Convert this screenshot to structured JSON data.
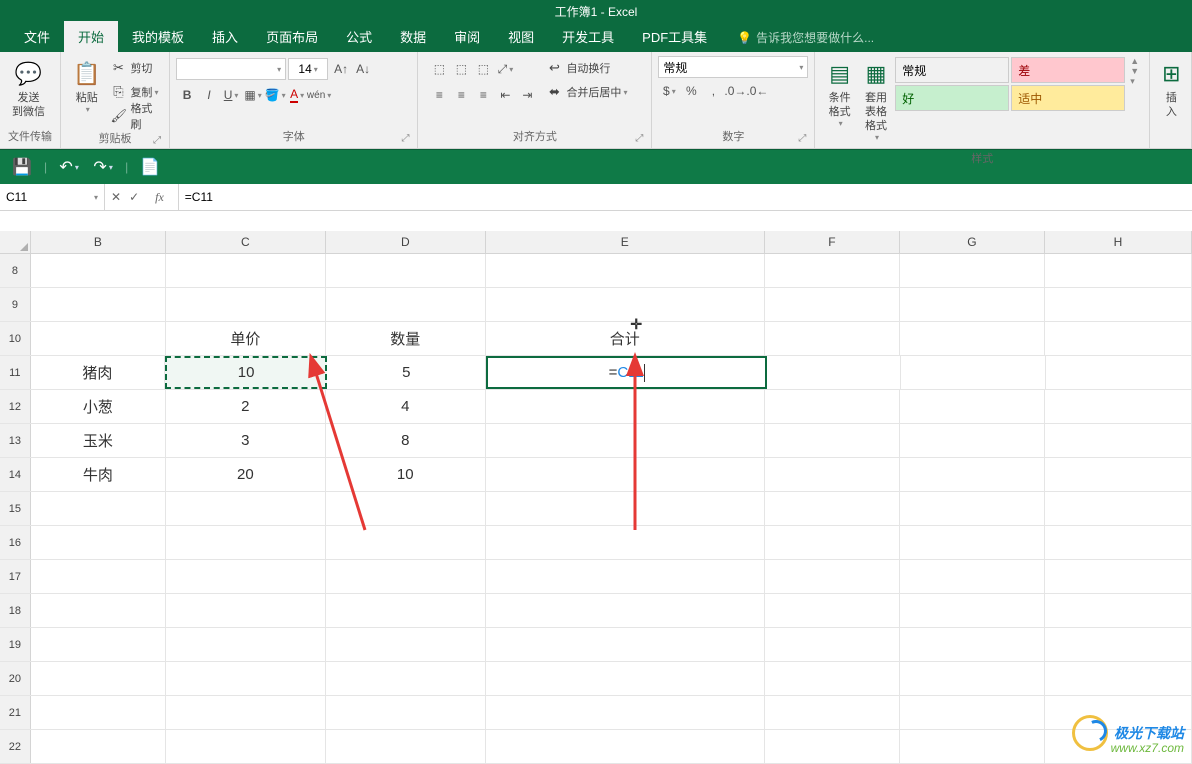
{
  "window": {
    "title": "工作簿1 - Excel"
  },
  "tabs": {
    "file": "文件",
    "home": "开始",
    "my_templates": "我的模板",
    "insert": "插入",
    "page_layout": "页面布局",
    "formulas": "公式",
    "data": "数据",
    "review": "审阅",
    "view": "视图",
    "developer": "开发工具",
    "pdf_tools": "PDF工具集",
    "tell_me": "告诉我您想要做什么..."
  },
  "ribbon": {
    "send_wechat": "发送\n到微信",
    "file_transfer": "文件传输",
    "paste": "粘贴",
    "cut": "剪切",
    "copy": "复制",
    "format_painter": "格式刷",
    "clipboard": "剪贴板",
    "font_name": "",
    "font_size": "14",
    "font_group": "字体",
    "wrap_text": "自动换行",
    "merge_center": "合并后居中",
    "alignment": "对齐方式",
    "number_format": "常规",
    "number_group": "数字",
    "cond_format": "条件格式",
    "table_format": "套用\n表格格式",
    "style_normal": "常规",
    "style_bad": "差",
    "style_good": "好",
    "style_neutral": "适中",
    "styles_group": "样式",
    "insert_btn": "插入"
  },
  "name_box": "C11",
  "formula_bar": "=C11",
  "columns": [
    "B",
    "C",
    "D",
    "E",
    "F",
    "G",
    "H"
  ],
  "rows": [
    "8",
    "9",
    "10",
    "11",
    "12",
    "13",
    "14",
    "15",
    "16",
    "17",
    "18",
    "19",
    "20",
    "21",
    "22"
  ],
  "headers": {
    "c": "单价",
    "d": "数量",
    "e": "合计"
  },
  "data": {
    "r11": {
      "b": "猪肉",
      "c": "10",
      "d": "5",
      "e_prefix": "=",
      "e_ref": "C11"
    },
    "r12": {
      "b": "小葱",
      "c": "2",
      "d": "4"
    },
    "r13": {
      "b": "玉米",
      "c": "3",
      "d": "8"
    },
    "r14": {
      "b": "牛肉",
      "c": "20",
      "d": "10"
    }
  },
  "watermark": {
    "text": "极光下载站",
    "url": "www.xz7.com"
  }
}
